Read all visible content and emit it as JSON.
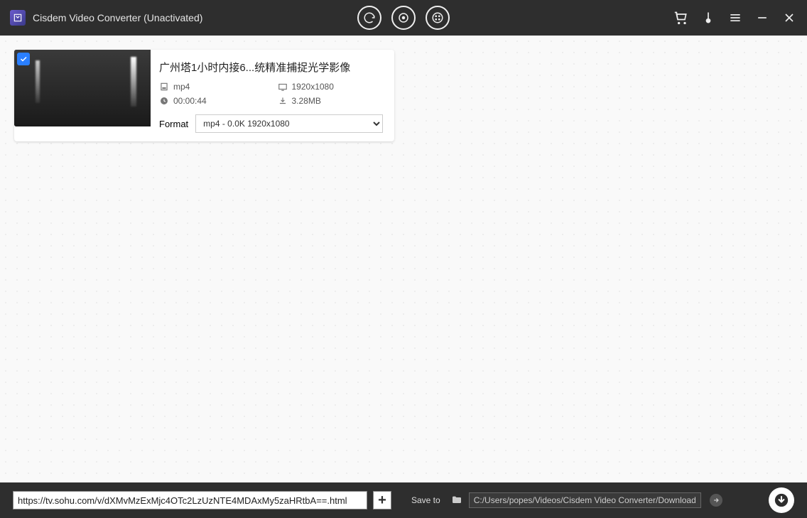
{
  "app": {
    "title": "Cisdem Video Converter (Unactivated)"
  },
  "video": {
    "title": "广州塔1小时内接6...统精准捕捉光学影像",
    "format_ext": "mp4",
    "resolution": "1920x1080",
    "duration": "00:00:44",
    "size": "3.28MB",
    "format_label": "Format",
    "format_option": "mp4 - 0.0K 1920x1080"
  },
  "bottom": {
    "url": "https://tv.sohu.com/v/dXMvMzExMjc4OTc2LzUzNTE4MDAxMy5zaHRtbA==.html",
    "save_to_label": "Save to",
    "save_path": "C:/Users/popes/Videos/Cisdem Video Converter/Download"
  }
}
